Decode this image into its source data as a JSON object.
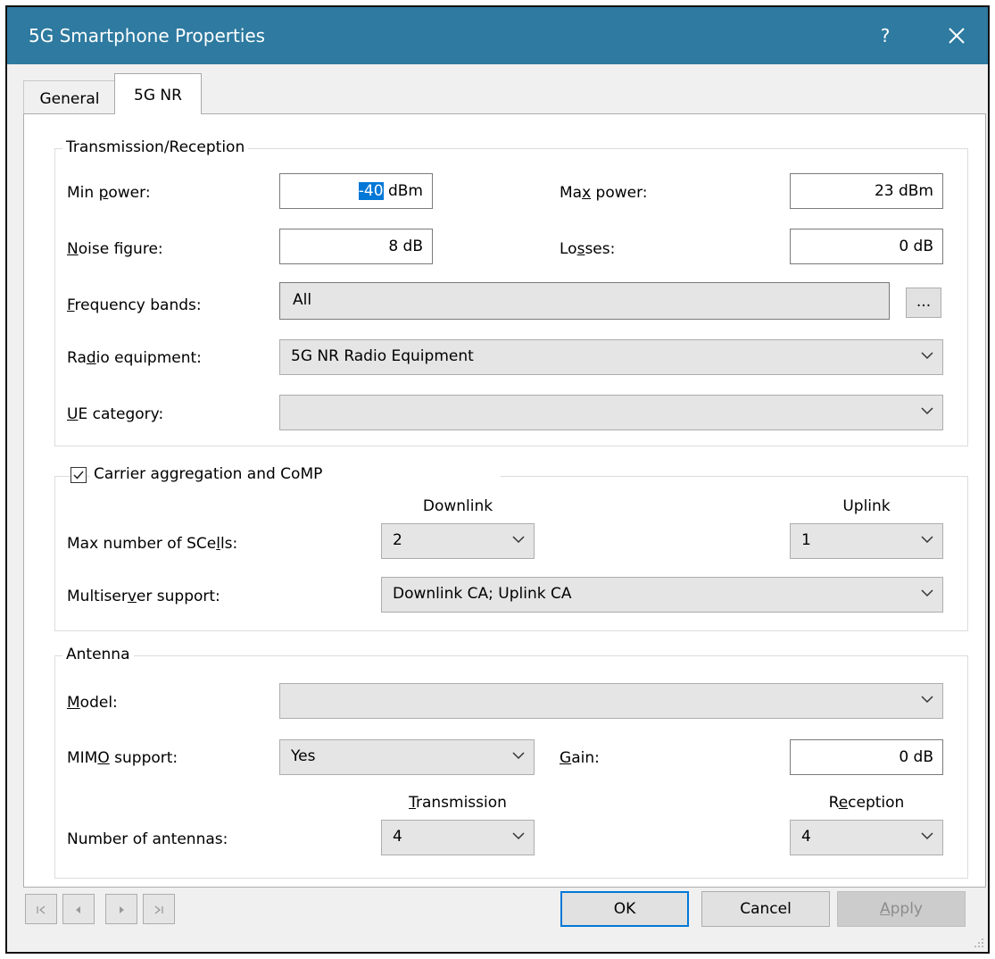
{
  "window": {
    "title": "5G Smartphone Properties",
    "help_label": "?"
  },
  "tabs": [
    {
      "label": "General"
    },
    {
      "label": "5G NR"
    }
  ],
  "transmission": {
    "legend": "Transmission/Reception",
    "min_power": {
      "label": "Min power:",
      "value_selected": "-40",
      "unit": " dBm"
    },
    "max_power": {
      "label": "Max power:",
      "value": "23  dBm"
    },
    "noise_figure": {
      "label": "Noise figure:",
      "value": "8  dB"
    },
    "losses": {
      "label": "Losses:",
      "value": "0  dB"
    },
    "frequency_bands": {
      "label": "Frequency bands:",
      "value": "All",
      "button": "..."
    },
    "radio_equipment": {
      "label": "Radio equipment:",
      "value": "5G NR Radio Equipment"
    },
    "ue_category": {
      "label": "UE category:",
      "value": ""
    }
  },
  "carrier": {
    "legend": "Carrier aggregation and CoMP",
    "checked": true,
    "downlink_header": "Downlink",
    "uplink_header": "Uplink",
    "max_scells": {
      "label": "Max number of SCells:",
      "downlink": "2",
      "uplink": "1"
    },
    "multiserver": {
      "label": "Multiserver support:",
      "value": "Downlink CA; Uplink CA"
    }
  },
  "antenna": {
    "legend": "Antenna",
    "model": {
      "label": "Model:",
      "value": ""
    },
    "mimo": {
      "label": "MIMO support:",
      "value": "Yes"
    },
    "gain": {
      "label": "Gain:",
      "value": "0  dB"
    },
    "transmission_header": "Transmission",
    "reception_header": "Reception",
    "num_antennas": {
      "label": "Number of antennas:",
      "transmission": "4",
      "reception": "4"
    }
  },
  "buttons": {
    "ok": "OK",
    "cancel": "Cancel",
    "apply": "Apply"
  },
  "colors": {
    "titlebar": "#2e7aa0",
    "selection": "#0078d7",
    "default_button_border": "#0078d7"
  }
}
